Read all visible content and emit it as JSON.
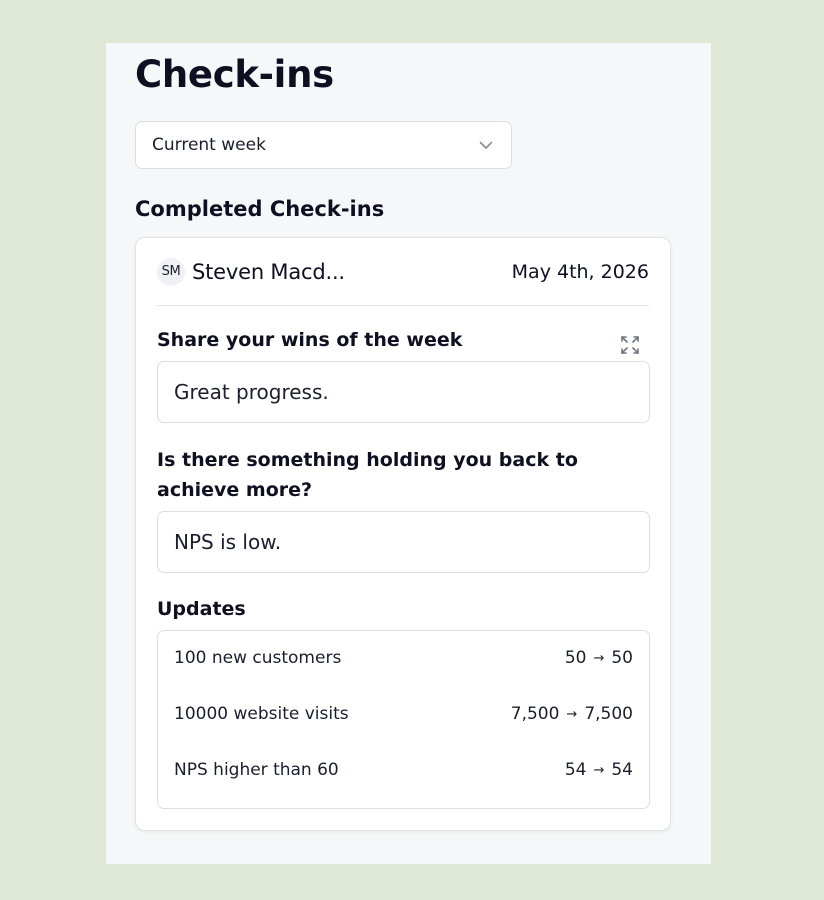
{
  "page": {
    "title": "Check-ins"
  },
  "filter": {
    "selected": "Current week"
  },
  "section": {
    "title": "Completed Check-ins"
  },
  "checkin": {
    "user": {
      "initials": "SM",
      "name": "Steven Macd..."
    },
    "date": "May 4th, 2026",
    "questions": [
      {
        "label": "Share your wins of the week",
        "answer": "Great progress."
      },
      {
        "label": "Is there something holding you back to achieve more?",
        "answer": "NPS is low."
      }
    ],
    "updates_label": "Updates",
    "updates": [
      {
        "name": "100 new customers",
        "from": "50",
        "to": "50"
      },
      {
        "name": "10000 website visits",
        "from": "7,500",
        "to": "7,500"
      },
      {
        "name": "NPS higher than 60",
        "from": "54",
        "to": "54"
      }
    ]
  },
  "icons": {
    "dropdown": "chevron-down-icon",
    "expand": "expand-icon",
    "arrow": "arrow-right-icon"
  },
  "colors": {
    "page_background": "#dfe8d5",
    "panel_background": "#f6f7f8",
    "card_background": "#ffffff",
    "text": "#0e1021",
    "border": "#dcdee3"
  }
}
